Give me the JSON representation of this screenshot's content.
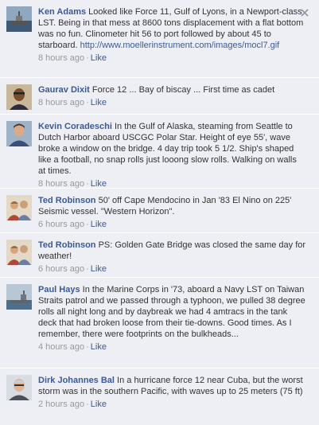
{
  "comments": [
    {
      "author": "Ken Adams",
      "text": "Looked like Force 11, Gulf of Lyons, in a Newport-class LST. Being in that mess at 8600 tons displacement with a flat bottom was no fun. Clinometer hit 56 to port followed by about 45 to starboard.",
      "link": "http://www.moellerinstrument.com/images/mocl7.gif",
      "time": "8 hours ago",
      "like_label": "Like",
      "avatar_icon": "ship-avatar-icon"
    },
    {
      "author": "Gaurav Dixit",
      "text": "Force 12 ... Bay of biscay ... First time as cadet",
      "time": "8 hours ago",
      "like_label": "Like",
      "avatar_icon": "person-avatar-icon"
    },
    {
      "author": "Kevin Coradeschi",
      "text": "In the Gulf of Alaska, steaming from Seattle to Dutch Harbor aboard USCGC Polar Star. Height of eye 55', wave broke a window on the bridge. 4 day trip took 5 1/2. Ship's shaped like a football, no snap rolls just looong slow rolls. Walking on walls at times.",
      "time": "8 hours ago",
      "like_label": "Like",
      "avatar_icon": "person-avatar-icon"
    },
    {
      "author": "Ted Robinson",
      "text": "50' off Cape Mendocino in Jan '83 El Nino on 225' Seismic vessel. \"Western Horizon\".",
      "time": "6 hours ago",
      "like_label": "Like",
      "avatar_icon": "couple-avatar-icon"
    },
    {
      "author": "Ted Robinson",
      "text": "PS: Golden Gate Bridge was closed the same day for weather!",
      "time": "6 hours ago",
      "like_label": "Like",
      "avatar_icon": "couple-avatar-icon"
    },
    {
      "author": "Paul Hays",
      "text": "In the Marine Corps in '73, aboard a Navy LST on Taiwan Straits patrol and we passed through a typhoon, we pulled 38 degree rolls all night long and by daybreak we had 4 amtracs in the tank deck that had broken loose from their tie-downs. Good times. As I remember, there were footprints on the bulkheads...",
      "time": "4 hours ago",
      "like_label": "Like",
      "avatar_icon": "ship-avatar-icon"
    },
    {
      "author": "Dirk Johannes Bal",
      "text": "In a hurricane force 12 near Cuba, but the worst storm was in the southern Pacific, with waves up to 25 meters (75 ft)",
      "time": "2 hours ago",
      "like_label": "Like",
      "avatar_icon": "person-avatar-icon"
    }
  ],
  "close_icon": "close-icon",
  "colors": {
    "link": "#3b5998",
    "meta": "#999999",
    "background": "#edeff4"
  }
}
